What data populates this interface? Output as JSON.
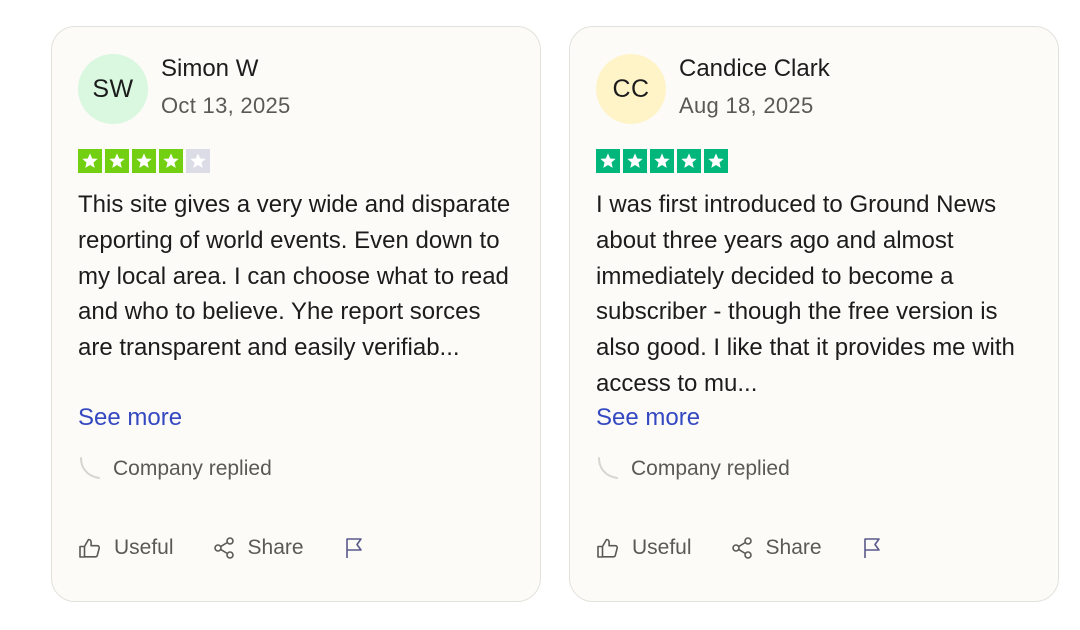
{
  "reviews": [
    {
      "initials": "SW",
      "avatar_color": "#d9f8df",
      "name": "Simon W",
      "date": "Oct 13, 2025",
      "rating": 4,
      "max_rating": 5,
      "star_color": "#73cf11",
      "body": "This site gives a very wide and disparate reporting of world events. Even down to my local area. I can choose what to read and who to believe. Yhe report sorces are transparent and easily verifiab...",
      "see_more": "See more",
      "company_replied": "Company replied",
      "useful": "Useful",
      "share": "Share"
    },
    {
      "initials": "CC",
      "avatar_color": "#fff4c8",
      "name": "Candice Clark",
      "date": "Aug 18, 2025",
      "rating": 5,
      "max_rating": 5,
      "star_color": "#00b67a",
      "body": "I was first introduced to Ground News about three years ago and almost immediately decided to become a subscriber - though the free version is also good. I like that it provides me with access to mu...",
      "see_more": "See more",
      "company_replied": "Company replied",
      "useful": "Useful",
      "share": "Share"
    }
  ],
  "colors": {
    "empty_star": "#dcdce6",
    "link": "#3449c0"
  }
}
